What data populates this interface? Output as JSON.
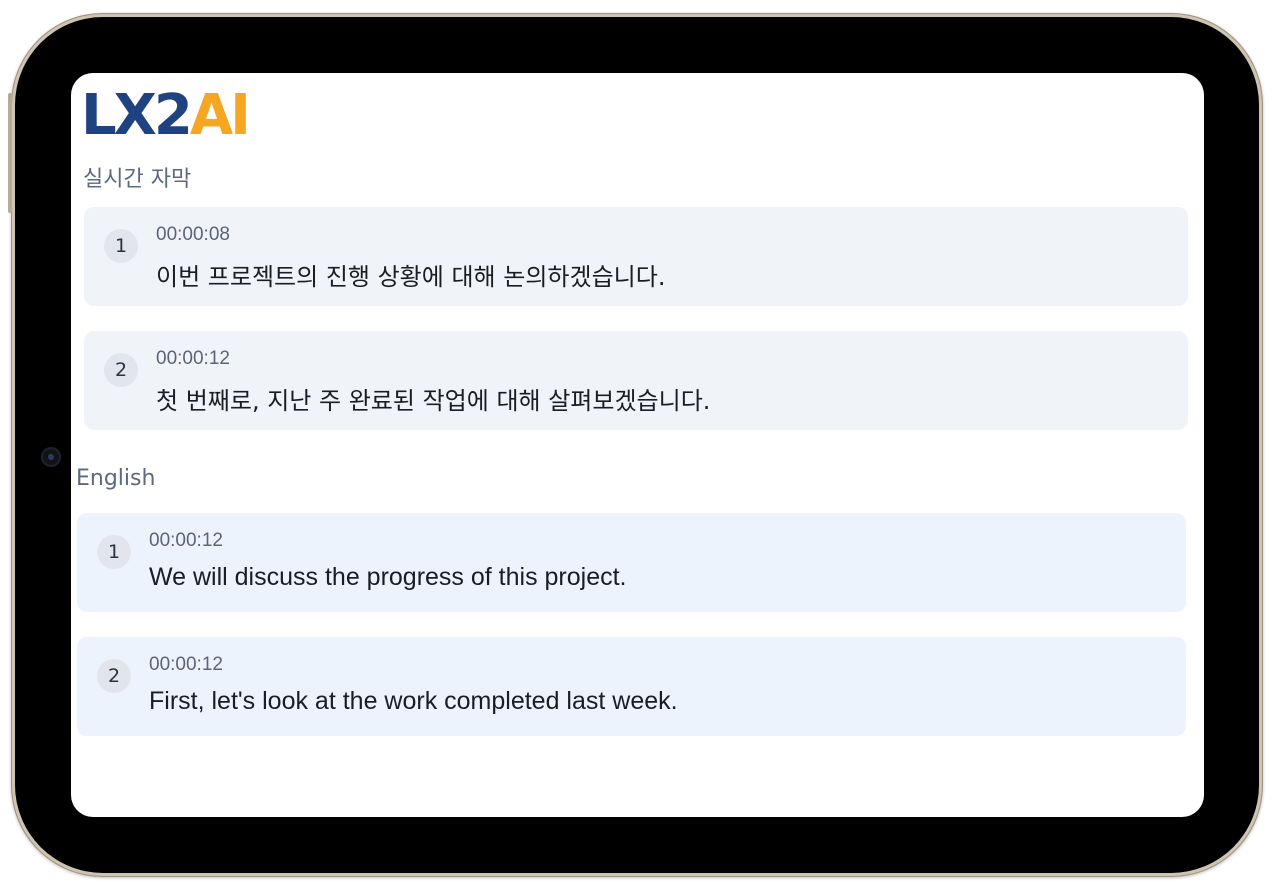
{
  "app": {
    "logo_left": "LX",
    "logo_mid": "2",
    "logo_right": "AI"
  },
  "korean_section": {
    "title": "실시간 자막",
    "items": [
      {
        "index": "1",
        "time": "00:00:08",
        "text": "이번 프로젝트의 진행 상황에 대해 논의하겠습니다."
      },
      {
        "index": "2",
        "time": "00:00:12",
        "text": "첫 번째로, 지난 주 완료된 작업에 대해 살펴보겠습니다."
      }
    ]
  },
  "english_section": {
    "title": "English",
    "items": [
      {
        "index": "1",
        "time": "00:00:12",
        "text": "We will discuss the progress of this project."
      },
      {
        "index": "2",
        "time": "00:00:12",
        "text": "First, let's look at the work completed last week."
      }
    ]
  },
  "colors": {
    "brand_blue": "#1f4381",
    "brand_orange": "#f5a623",
    "korean_card_bg": "#f0f3f7",
    "english_card_bg": "#ecf3fd"
  }
}
